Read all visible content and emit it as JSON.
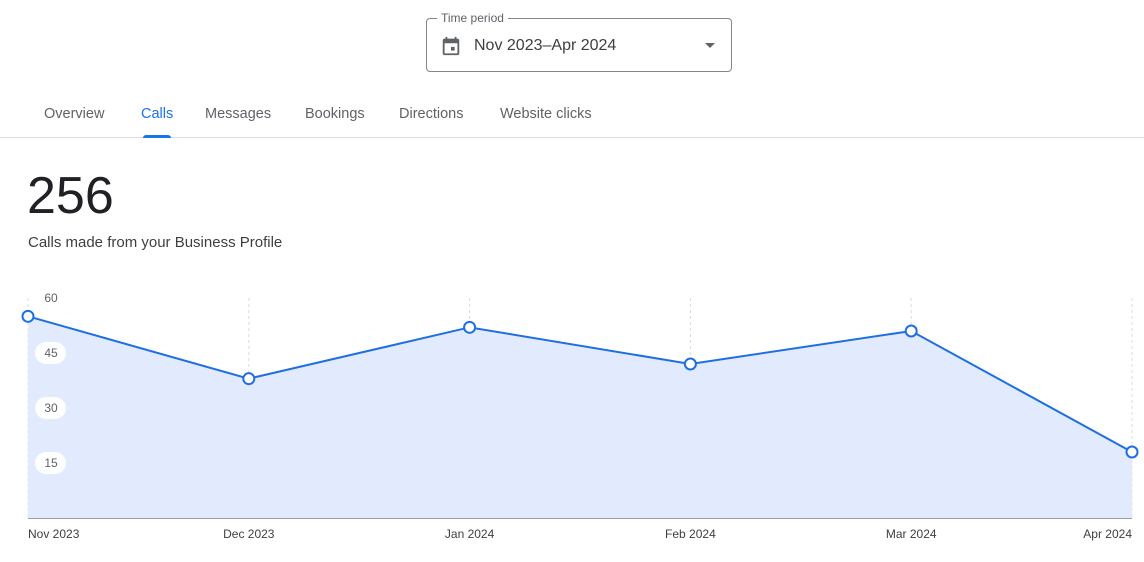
{
  "time_period": {
    "label": "Time period",
    "value": "Nov 2023–Apr 2024",
    "icon": "calendar-icon"
  },
  "tabs": [
    {
      "label": "Overview",
      "active": false
    },
    {
      "label": "Calls",
      "active": true
    },
    {
      "label": "Messages",
      "active": false
    },
    {
      "label": "Bookings",
      "active": false
    },
    {
      "label": "Directions",
      "active": false
    },
    {
      "label": "Website clicks",
      "active": false
    }
  ],
  "metric": {
    "value": "256",
    "caption": "Calls made from your Business Profile"
  },
  "colors": {
    "accent": "#1a73e8",
    "line": "#1f6fe0",
    "area": "#e1ebfd"
  },
  "chart_data": {
    "type": "area",
    "categories": [
      "Nov 2023",
      "Dec 2023",
      "Jan 2024",
      "Feb 2024",
      "Mar 2024",
      "Apr 2024"
    ],
    "series": [
      {
        "values": [
          55,
          38,
          52,
          42,
          51,
          18
        ]
      }
    ],
    "ylim": [
      0,
      60
    ],
    "yticks": [
      15,
      30,
      45,
      60
    ],
    "grid": "vertical-dashed",
    "legend": "none"
  }
}
